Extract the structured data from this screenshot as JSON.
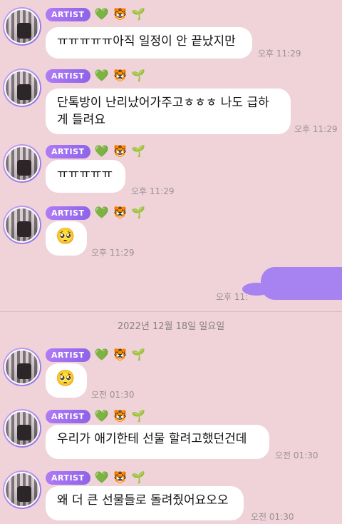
{
  "badge_label": "ARTIST",
  "badge_emojis": {
    "heart": "💚",
    "tiger": "🐯",
    "sprout": "🌱"
  },
  "messages": [
    {
      "text": "ㅠㅠㅠㅠㅠ아직 일정이 안 끝났지만",
      "time": "오후 11:29"
    },
    {
      "text": "단톡방이 난리났어가주고ㅎㅎㅎ 나도 급하게 들려요",
      "time": "오후 11:29"
    },
    {
      "text": "ㅠㅠㅠㅠㅠ",
      "time": "오후 11:29"
    },
    {
      "text": "🥺",
      "time": "오후 11:29"
    },
    {
      "text": "🥺",
      "time": "오전 01:30"
    },
    {
      "text": "우리가 애기한테 선물 할려고했던건데",
      "time": "오전 01:30"
    },
    {
      "text": "왜 더 큰 선물들로 돌려줬어요오오",
      "time": "오전 01:30"
    }
  ],
  "sent_message": {
    "time": "오후 11:"
  },
  "date_divider": "2022년 12월 18일 일요일",
  "colors": {
    "background": "#EFD3D9",
    "badge": "#9B6FEF",
    "sent_bubble": "#A683F0"
  }
}
